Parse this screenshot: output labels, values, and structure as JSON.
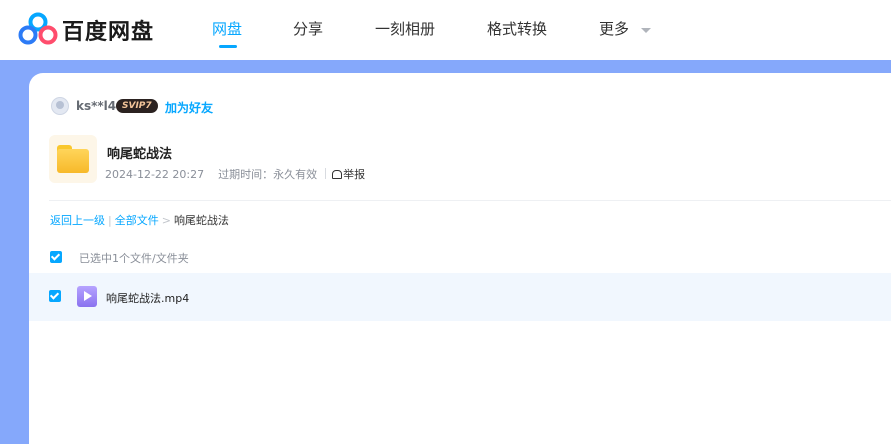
{
  "app": {
    "logo_text": "百度网盘",
    "accent_color": "#06a7ff",
    "band_color": "#85a8fb"
  },
  "nav": {
    "items": [
      {
        "label": "网盘",
        "active": true
      },
      {
        "label": "分享",
        "active": false
      },
      {
        "label": "一刻相册",
        "active": false
      },
      {
        "label": "格式转换",
        "active": false
      },
      {
        "label": "更多",
        "active": false
      }
    ]
  },
  "sharer": {
    "username": "ks**l4",
    "badge": "SVIP7",
    "add_friend_label": "加为好友"
  },
  "share": {
    "title": "响尾蛇战法",
    "date": "2024-12-22 20:27",
    "expiry_label": "过期时间：",
    "expiry_value": "永久有效",
    "report_label": "举报"
  },
  "breadcrumb": {
    "back_label": "返回上一级",
    "separator": "|",
    "all_files_label": "全部文件",
    "arrow": ">",
    "current": "响尾蛇战法"
  },
  "selection": {
    "text": "已选中1个文件/文件夹"
  },
  "files": [
    {
      "name": "响尾蛇战法.mp4",
      "type": "video",
      "checked": true
    }
  ]
}
